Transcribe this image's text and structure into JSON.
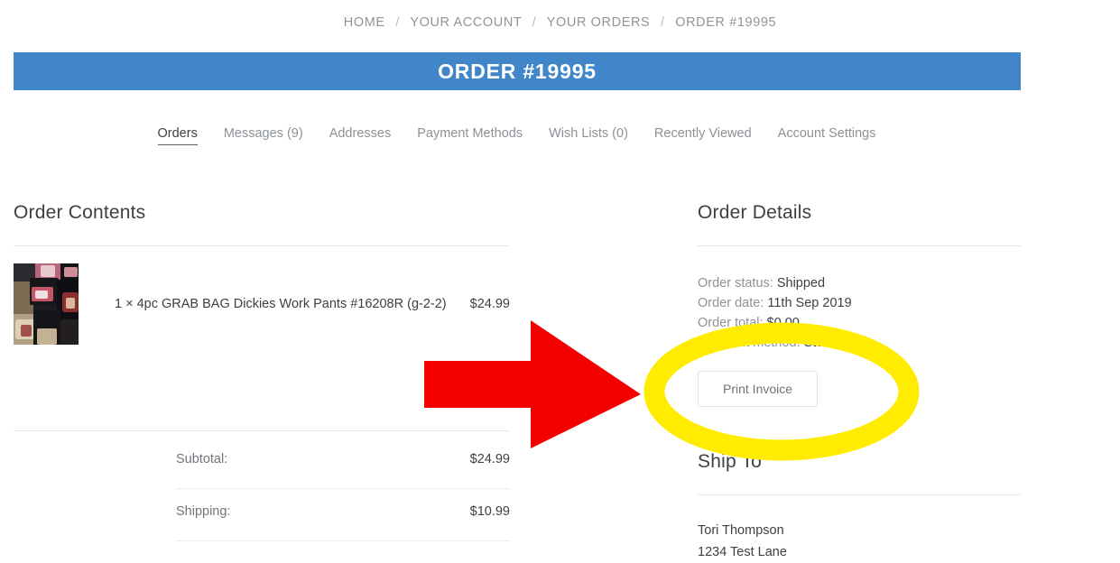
{
  "breadcrumb": {
    "items": [
      "HOME",
      "YOUR ACCOUNT",
      "YOUR ORDERS",
      "ORDER #19995"
    ],
    "separator": "/"
  },
  "banner": {
    "title": "ORDER #19995",
    "background_color": "#4186c8",
    "text_color": "#ffffff"
  },
  "account_nav": {
    "tabs": [
      {
        "label": "Orders",
        "active": true
      },
      {
        "label": "Messages (9)",
        "active": false
      },
      {
        "label": "Addresses",
        "active": false
      },
      {
        "label": "Payment Methods",
        "active": false
      },
      {
        "label": "Wish Lists (0)",
        "active": false
      },
      {
        "label": "Recently Viewed",
        "active": false
      },
      {
        "label": "Account Settings",
        "active": false
      }
    ]
  },
  "order_contents": {
    "heading": "Order Contents",
    "item": {
      "quantity_label": "1 ×",
      "name": "4pc GRAB BAG Dickies Work Pants #16208R (g-2-2)",
      "full_line": "1 × 4pc GRAB BAG Dickies Work Pants #16208R (g-2-2)",
      "price": "$24.99",
      "image_alt": "4pc GRAB BAG Dickies Work Pants product photo"
    },
    "totals": [
      {
        "label": "Subtotal:",
        "value": "$24.99"
      },
      {
        "label": "Shipping:",
        "value": "$10.99"
      }
    ]
  },
  "order_details": {
    "heading": "Order Details",
    "fields": [
      {
        "label": "Order status:",
        "value": "Shipped"
      },
      {
        "label": "Order date:",
        "value": "11th Sep 2019"
      },
      {
        "label": "Order total:",
        "value": "$0.00"
      },
      {
        "label": "Payment method:",
        "value": "Store credit"
      }
    ],
    "print_invoice_label": "Print Invoice"
  },
  "ship_to": {
    "heading": "Ship To",
    "lines": [
      "Tori Thompson",
      "1234 Test Lane"
    ]
  },
  "annotations": {
    "arrow": {
      "color": "#f50000",
      "direction": "right",
      "points_to": "print-invoice-button"
    },
    "highlight_ellipse": {
      "color": "#ffec00",
      "encircles": "print-invoice-button"
    }
  }
}
